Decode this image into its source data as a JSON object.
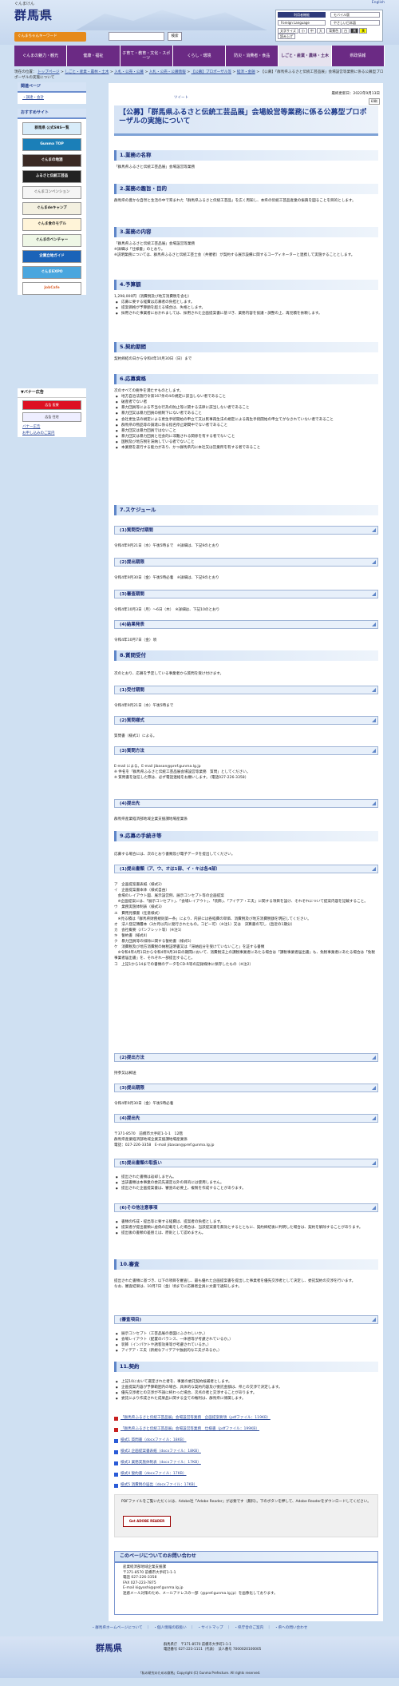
{
  "header": {
    "logo_kana": "ぐんまけん",
    "logo_kanji": "群馬県",
    "logo_sub": "Gunma Prefecture",
    "chara_btn": "ぐんまちゃんキーワード",
    "search_btn": "検索",
    "english": "English",
    "tools_title": "利用者機能",
    "mobile": "モバイル版",
    "lang": "Foreign Language",
    "easy": "やさしい日本語",
    "fontsize": "文字サイズ",
    "sizes": [
      "小",
      "中",
      "大"
    ],
    "color": "背景色",
    "colors": [
      "白",
      "黒",
      "黄"
    ],
    "listen": "読み上げ"
  },
  "nav": [
    "ぐんまの魅力・観光",
    "健康・福祉",
    "子育て・教育・文化・スポーツ",
    "くらし・環境",
    "防災・消費者・食品",
    "しごと・産業・農林・土木",
    "県政情報"
  ],
  "breadcrumb": {
    "items": [
      "現在の位置：",
      "トップページ",
      "しごと・産業・農林・土木",
      "入札・公売・公募",
      "入札・公売・公募情報",
      "【公募】プロポーザル等",
      "経済・金融",
      "【公募】「群馬県ふるさと伝統工芸品展」会場設営等業務に係る公募型プロポーザルの実施について"
    ]
  },
  "side": {
    "related": "関連ページ",
    "related_link": "・調達・会計",
    "osusume": "おすすめサイト",
    "banners": [
      "群馬県 公式SNS一覧",
      "Gunma TOP",
      "ぐんまの地酒",
      "ふるさと伝統工芸品",
      "ぐんまコンベンション",
      "ぐんまdeキャンプ",
      "ぐんま食のモデル",
      "ぐんまのベンチャー",
      "企業立地ガイド",
      "ぐんまEXPO",
      "JobCafe"
    ],
    "pr_title": "▼バナー広告",
    "pr_banners": [
      "広告 医療",
      "広告 住宅"
    ],
    "pr_links": [
      "バナー広告",
      "お申し込みのご案内"
    ]
  },
  "page": {
    "tweet": "ツイート",
    "date": "最終更新日：2022年9月13日",
    "print": "印刷",
    "title": "【公募】「群馬県ふるさと伝統工芸品展」会場設営等業務に係る公募型プロポーザルの実施について"
  },
  "sections": {
    "s1": "1.業務の名称",
    "s1p": "「群馬県ふるさと伝統工芸品展」会場設営等業務",
    "s2": "2.業務の趣旨・目的",
    "s2p": "群馬県の豊かな自然と生活の中で育まれた「群馬県ふるさと伝統工芸品」を広く周知し、本県の伝統工芸品産業の振興を図ることを目的とします。",
    "s3": "3.業務の内容",
    "s3p1": "「群馬県ふるさと伝統工芸品展」会場設営等業務",
    "s3p2": "※詳細は「仕様書」のとおり。",
    "s3p3": "※説明業務については、群馬県ふるさと伝統工芸士会（共催者）が契約する展示設備に関するコーディネーターと連携して実施することとします。",
    "s4": "4.予算額",
    "s4p": "1,298,000円（消費税及び地方消費税を含む）",
    "s4l": [
      "応募に要する経費は応募者の負担とします。",
      "提案価格が予算額を超える場合は、失格とします。",
      "採用された事業者におかれましては、採用された企画提案書に基づき、業務内容を協議・調整の上、再見積を依頼します。"
    ],
    "s5": "5.契約期間",
    "s5p": "契約締結の日から令和4年10月30日（日）まで",
    "s6": "6.応募資格",
    "s6p": "次のすべての要件を満たすものとします。",
    "s6l": [
      "地方自治法施行令第167条の4の規定に該当しない者であること",
      "破産者でない者",
      "暴力団員等による不当な行為の防止等に関する法律に該当しない者であること",
      "暴力団又は暴力団員の統制下にない者であること",
      "会社更生法の規定による更生手続開始の申立て又は民事再生法の規定による再生手続開始の申立てがなされていない者であること",
      "群馬県の物品等の調達に係る指名停止期間中でない者であること",
      "暴力団又は暴力団員ではないこと",
      "暴力団又は暴力団員と社会的に非難される関係を有する者でないこと",
      "国税及び地方税を滞納している者でないこと",
      "本業務を遂行する能力があり、かつ群馬県内に本社又は営業所を有する者であること"
    ],
    "s7": "7.スケジュール",
    "q1": "(1)質問受付期間",
    "q1p": "令和4年9月21日（水）午後5時まで　※詳細は、下記9のとおり",
    "q2": "(2)提出期限",
    "q2p": "令和4年9月30日（金）午後5時必着　※詳細は、下記9のとおり",
    "q3": "(3)審査期間",
    "q3p": "令和4年10月3日（月）～6日（木）　※詳細は、下記10のとおり",
    "q4": "(4)結果発表",
    "q4p": "令和4年10月7日（金）頃",
    "s8": "8.質問受付",
    "s8p": "次のとおり、応募を予定している事業者から質問を受け付けます。",
    "r1": "(1)受付期間",
    "r1p": "令和4年9月21日（水）午後5時まで",
    "r2": "(2)質問様式",
    "r2p": "質問書（様式1）による。",
    "r3": "(3)質問方法",
    "r3p1": "E-mail による。E-mail jibasan@pref.gunma.lg.jp",
    "r3p2": "※ 件名を「群馬県ふるさと伝統工芸品展会場設営等業務　質問」としてください。",
    "r3p3": "※ 質問書を送信した際は、必ず電話連絡をお願いします。（電話027-226-3358）",
    "r4": "(4)提出先",
    "r4p": "群馬県産業経済部地域企業支援課地場産業係",
    "s9": "9.応募の手続き等",
    "s9p": "応募する場合には、次のとおり書類及び電子データを提出してください。",
    "t1": "(1)提出書類（ア、ウ、オは1部、イ・キは各4部）",
    "t1p": [
      "ア　企画提案書表紙（様式2）",
      "イ　企画提案書本体（様式自由）",
      "　会場のレイアウト図、展示設営例、展示コンセプト等の企画提案",
      "　※企画提案には、「展示コンセプト」、「会場レイアウト」、「装飾」、「アイデア・工夫」に関する項目を設け、それぞれについて提案内容を記載すること。",
      "ウ　業務実施体制表（様式3）",
      "エ　費用見積書（任意様式）",
      "　※見る積は「群馬県財務規則第一条」により、内訳には各経費の単価、消費税及び地方消費税額を明記してください。",
      "オ　法人登記簿謄本（3か月以内に発行されたもの。コピー可）（※注1）又は　決算書の写し（直近の1期分）",
      "カ　会社概要（パンフレット等）（※注1）",
      "キ　誓約書（様式4）",
      "ク　暴力団員等の排除に関する誓約書（様式5）",
      "ケ　消費税及び地方消費税の納税証明書又は「滞納処分を受けていないこと」を証する書類",
      "　※令和4年4月1日から令和4年9月30日の期間において、消費税法上の課税事業者にあたる場合は「課税事業者届出書」も、免税事業者にあたる場合は「免税事業者届出書」を、それぞれ一部提出すること。",
      "コ　上記1から14までの書類のデータをCD-R等の記録媒体に保存したもの（※注2）"
    ],
    "t2": "(2)提出方法",
    "t2p": "持参又は郵送",
    "t3": "(3)提出期限",
    "t3p": "令和4年9月30日（金）午後5時必着",
    "t4": "(4)提出先",
    "t4p": [
      "〒371-8570　前橋市大手町1-1-1　12階",
      "群馬県産業経済部地域企業支援課地場産業係",
      "電話：027-226-3358　E-mail jibasan@pref.gunma.lg.jp"
    ],
    "t5": "(5)提出書類の取扱い",
    "t5l": [
      "提出された書類は返却しません。",
      "当該書類は本事業の委託先選定以外の目的には使用しません。",
      "提出された企画提案書は、審査の必要上、複製を作成することがあります。"
    ],
    "t6": "(6)その他注意事項",
    "t6l": [
      "書類の作成・提出等に要する経費は、提案者の負担とします。",
      "提案者が提出書類に虚偽の記載をした場合は、当該提案書を無効とするとともに、契約締結後に判明した場合は、契約を解除することがあります。",
      "提出後の書類の差替えは、原則として認めません。"
    ],
    "s10": "10.審査",
    "s10p1": "提出された書類に基づき、以下の項目を審査し、最も優れた企画提案書を提出した事業者を優先交渉者として決定し、委託契約の交渉を行います。",
    "s10p2": "なお、審査結果は、10月7日（金）頃までに応募者全員に文書で通知します。",
    "u1": "(審査項目)",
    "u1l": [
      "展示コンセプト（工芸品展の意図にふさわしいか。）",
      "会場レイアウト（配置のバランス、一体感等が考慮されているか。）",
      "装飾（インパクトや誘客効果等が考慮されているか。）",
      "アイデア・工夫（新規なアイデアや独創的な工夫があるか。）"
    ],
    "s11": "11.契約",
    "s11l": [
      "上記10において選定された者を、事業の委託契約候補者とします。",
      "企画提案内容が予算範囲内の場合、具体的な契約内容及び委託金額は、県との交渉で決定します。",
      "優先交渉者との交渉が不調に終わった場合、次点の者と交渉することがあります。",
      "委託により作成された成果品に関する全ての権利は、群馬県に帰属します。"
    ]
  },
  "files": [
    {
      "t": "「群馬県ふるさと伝統工芸品展」会場設営等業務　企画提案要領（pdfファイル：119KB）",
      "w": false
    },
    {
      "t": "「群馬県ふるさと伝統工芸品展」会場設営等業務　仕様書（pdfファイル：199KB）",
      "w": false
    },
    {
      "t": "様式1 質問書（docxファイル：18KB）",
      "w": true
    },
    {
      "t": "様式2 企画提案書表紙（docxファイル：18KB）",
      "w": true
    },
    {
      "t": "様式3 業務実施体制表（docxファイル：17KB）",
      "w": true
    },
    {
      "t": "様式4 誓約書（docxファイル：17KB）",
      "w": true
    },
    {
      "t": "様式5 消費税の届出（docxファイル：17KB）",
      "w": true
    }
  ],
  "pdf": {
    "text": "PDFファイルをご覧いただくには、Adobe社「Adobe Reader」が必要です（無料）。下のボタンを押して、Adobe Readerをダウンロードしてください。",
    "btn": "Get ADOBE READER"
  },
  "contact": {
    "title": "このページについてのお問い合わせ",
    "lines": [
      "産業経済部地域企業支援課",
      "〒371-8570 前橋市大手町1-1-1",
      "電話 027-226-3358",
      "FAX 027-223-7875",
      "E-mail kigyoshi@pref.gunma.lg.jp",
      "迷惑メール対策のため、メールアドレスの一部（@pref.gunma.lg.jp）を画像化しております。"
    ]
  },
  "footer": {
    "links": "・群馬県ホームページについて　｜　・個人情報の取扱い　｜　・サイトマップ　｜　・県庁舎のご案内　｜　・県への問い合わせ",
    "logo": "群馬県",
    "addr": [
      "群馬県庁　〒371-8570 前橋市大手町1-1-1",
      "電話番号 027-223-1111（代表）　法人番号 7000020100005"
    ],
    "copy": "「私の研究のための群馬」Copyright (C) Gunma Prefecture. All rights reserved."
  }
}
